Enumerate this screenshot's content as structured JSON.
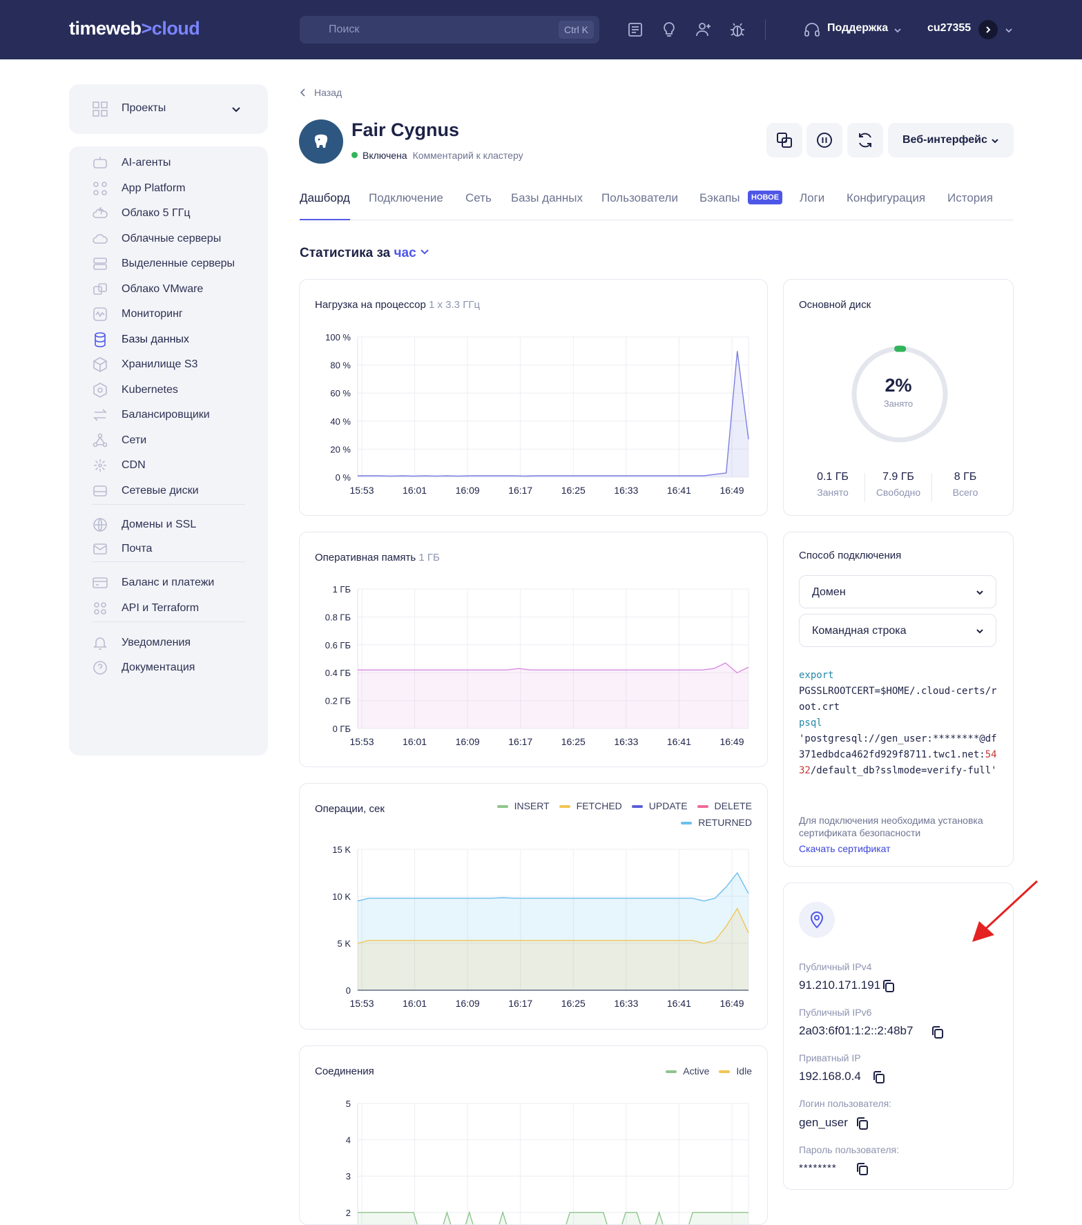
{
  "topbar": {
    "logo_main": "timeweb",
    "logo_accent": ">cloud",
    "search_placeholder": "Поиск",
    "search_shortcut": "Ctrl K",
    "support_label": "Поддержка",
    "user_name": "cu27355",
    "icons": [
      "docs-icon",
      "idea-icon",
      "add-user-icon",
      "bug-icon",
      "headset-icon"
    ]
  },
  "sidebar": {
    "projects_label": "Проекты",
    "items": [
      {
        "label": "AI-агенты",
        "icon": "robot-icon"
      },
      {
        "label": "App Platform",
        "icon": "apps-icon"
      },
      {
        "label": "Облако 5 ГГц",
        "icon": "lightning-cloud-icon"
      },
      {
        "label": "Облачные серверы",
        "icon": "cloud-icon"
      },
      {
        "label": "Выделенные серверы",
        "icon": "server-icon"
      },
      {
        "label": "Облако VMware",
        "icon": "vmware-icon"
      },
      {
        "label": "Мониторинг",
        "icon": "monitoring-icon"
      },
      {
        "label": "Базы данных",
        "icon": "database-icon"
      },
      {
        "label": "Хранилище S3",
        "icon": "cube-icon"
      },
      {
        "label": "Kubernetes",
        "icon": "kubernetes-icon"
      },
      {
        "label": "Балансировщики",
        "icon": "arrows-icon"
      },
      {
        "label": "Сети",
        "icon": "network-icon"
      },
      {
        "label": "CDN",
        "icon": "cdn-icon"
      },
      {
        "label": "Сетевые диски",
        "icon": "disk-icon"
      },
      {
        "label": "Домены и SSL",
        "icon": "globe-icon"
      },
      {
        "label": "Почта",
        "icon": "mail-icon"
      },
      {
        "label": "Баланс и платежи",
        "icon": "card-icon"
      },
      {
        "label": "API и Terraform",
        "icon": "api-icon"
      },
      {
        "label": "Уведомления",
        "icon": "bell-icon"
      },
      {
        "label": "Документация",
        "icon": "help-icon"
      }
    ],
    "active_item": "Базы данных"
  },
  "header": {
    "back_label": "Назад",
    "title": "Fair Cygnus",
    "status": "Включена",
    "comment": "Комментарий к кластеру",
    "web_ui_label": "Веб-интерфейс"
  },
  "tabs": [
    {
      "label": "Дашборд",
      "active": true
    },
    {
      "label": "Подключение"
    },
    {
      "label": "Сеть"
    },
    {
      "label": "Базы данных"
    },
    {
      "label": "Пользователи"
    },
    {
      "label": "Бэкапы"
    },
    {
      "label": "Логи"
    },
    {
      "label": "Конфигурация"
    },
    {
      "label": "История"
    }
  ],
  "backups_badge": "НОВОЕ",
  "stats": {
    "title": "Статистика за",
    "period": "час"
  },
  "chart_data": [
    {
      "type": "area",
      "title": "Нагрузка на процессор",
      "subtitle": "1 x 3.3 ГГц",
      "x": [
        "15:53",
        "16:01",
        "16:09",
        "16:17",
        "16:25",
        "16:33",
        "16:41",
        "16:49"
      ],
      "yticks": [
        "100 %",
        "80 %",
        "60 %",
        "40 %",
        "20 %",
        "0 %"
      ],
      "ylim": [
        0,
        100
      ],
      "series": [
        {
          "color": "#7b7fdf",
          "values": [
            1,
            1,
            1,
            0.8,
            1,
            0.8,
            1,
            0.8,
            1,
            0.8,
            1,
            1,
            1,
            1,
            1,
            0.8,
            1,
            1,
            1,
            1,
            1,
            1,
            1,
            1,
            1,
            1,
            1,
            1,
            1,
            1,
            1,
            1,
            2,
            3,
            90,
            27
          ]
        }
      ]
    },
    {
      "type": "area",
      "title": "Оперативная память",
      "subtitle": "1 ГБ",
      "x": [
        "15:53",
        "16:01",
        "16:09",
        "16:17",
        "16:25",
        "16:33",
        "16:41",
        "16:49"
      ],
      "yticks": [
        "1 ГБ",
        "0.8 ГБ",
        "0.6 ГБ",
        "0.4 ГБ",
        "0.2 ГБ",
        "0 ГБ"
      ],
      "ylim": [
        0,
        1
      ],
      "series": [
        {
          "color": "#d98be0",
          "values": [
            0.42,
            0.42,
            0.42,
            0.42,
            0.42,
            0.42,
            0.42,
            0.42,
            0.42,
            0.42,
            0.42,
            0.42,
            0.42,
            0.42,
            0.43,
            0.42,
            0.42,
            0.42,
            0.42,
            0.42,
            0.42,
            0.42,
            0.42,
            0.42,
            0.42,
            0.42,
            0.42,
            0.42,
            0.42,
            0.42,
            0.42,
            0.43,
            0.47,
            0.4,
            0.44
          ]
        }
      ]
    },
    {
      "type": "area",
      "title": "Операции, сек",
      "x": [
        "15:53",
        "16:01",
        "16:09",
        "16:17",
        "16:25",
        "16:33",
        "16:41",
        "16:49"
      ],
      "yticks": [
        "15 K",
        "10 K",
        "5 K",
        "0"
      ],
      "ylim": [
        0,
        15000
      ],
      "legend": [
        "INSERT",
        "FETCHED",
        "UPDATE",
        "DELETE",
        "RETURNED"
      ],
      "legend_colors": [
        "#8fc58c",
        "#f1c554",
        "#5b5fd9",
        "#ef6a9a",
        "#6cbff0"
      ],
      "series": [
        {
          "name": "RETURNED",
          "color": "#6cbff0",
          "values": [
            9500,
            9800,
            9800,
            9800,
            9800,
            9800,
            9800,
            9800,
            9800,
            9800,
            9800,
            9800,
            9800,
            9850,
            9800,
            9800,
            9800,
            9800,
            9800,
            9800,
            9800,
            9800,
            9800,
            9800,
            9800,
            9800,
            9800,
            9800,
            9800,
            9800,
            9800,
            9500,
            9800,
            11000,
            12500,
            10300
          ]
        },
        {
          "name": "FETCHED",
          "color": "#f1c554",
          "values": [
            5000,
            5300,
            5300,
            5300,
            5300,
            5300,
            5300,
            5300,
            5300,
            5300,
            5300,
            5300,
            5300,
            5300,
            5300,
            5300,
            5300,
            5300,
            5300,
            5300,
            5300,
            5300,
            5300,
            5300,
            5300,
            5300,
            5300,
            5300,
            5300,
            5300,
            5300,
            5000,
            5300,
            6800,
            8700,
            6100
          ]
        },
        {
          "name": "INSERT",
          "color": "#8fc58c",
          "values": [
            0,
            0,
            0,
            0,
            0,
            0,
            0,
            0,
            0,
            0,
            0,
            0,
            0,
            0,
            0,
            0,
            0,
            0,
            0,
            0,
            0,
            0,
            0,
            0,
            0,
            0,
            0,
            0,
            0,
            0,
            0,
            0,
            0,
            0,
            0,
            0
          ]
        }
      ]
    },
    {
      "type": "area",
      "title": "Соединения",
      "x": [
        "15:53",
        "16:01",
        "16:09",
        "16:17",
        "16:25",
        "16:33",
        "16:41",
        "16:49"
      ],
      "yticks": [
        "5",
        "4",
        "3",
        "2"
      ],
      "ylim": [
        0,
        5
      ],
      "legend": [
        "Active",
        "Idle"
      ],
      "legend_colors": [
        "#8fc58c",
        "#f1c554"
      ],
      "series": [
        {
          "name": "Active",
          "color": "#8fc58c",
          "values": [
            2,
            2,
            2,
            2,
            2,
            2,
            1,
            1,
            2,
            1,
            2,
            1,
            1,
            2,
            1,
            1,
            1,
            1,
            1,
            2,
            2,
            2,
            2,
            1,
            2,
            2,
            1,
            2,
            1,
            1,
            2,
            2,
            2,
            2,
            2,
            2
          ]
        }
      ]
    }
  ],
  "disk": {
    "title": "Основной диск",
    "percent": "2%",
    "percent_value": 2,
    "percent_label": "Занято",
    "used_value": "0.1 ГБ",
    "used_label": "Занято",
    "free_value": "7.9 ГБ",
    "free_label": "Свободно",
    "total_value": "8 ГБ",
    "total_label": "Всего"
  },
  "connection": {
    "title": "Способ подключения",
    "select_host": "Домен",
    "select_method": "Командная строка",
    "code": {
      "export_kw": "export",
      "export_value": "PGSSLROOTCERT=$HOME/.cloud-certs/root.crt",
      "psql_kw": "psql",
      "conn_prefix": "'postgresql://gen_user:********@df371edbdca462fd929f8711.twc1.net:",
      "port": "5432",
      "conn_suffix": "/default_db?sslmode=verify-full'"
    },
    "note": "Для подключения необходима установка сертификата безопасности",
    "download_label": "Скачать сертификат"
  },
  "network": {
    "ipv4_label": "Публичный IPv4",
    "ipv4": "91.210.171.191",
    "ipv6_label": "Публичный IPv6",
    "ipv6": "2a03:6f01:1:2::2:48b7",
    "private_label": "Приватный IP",
    "private_ip": "192.168.0.4",
    "login_label": "Логин пользователя:",
    "login": "gen_user",
    "password_label": "Пароль пользователя:",
    "password": "********"
  },
  "colors": {
    "topbar": "#272d58",
    "accent": "#4e56e8",
    "status_on": "#31b45a",
    "annotation_arrow": "#e52222"
  }
}
